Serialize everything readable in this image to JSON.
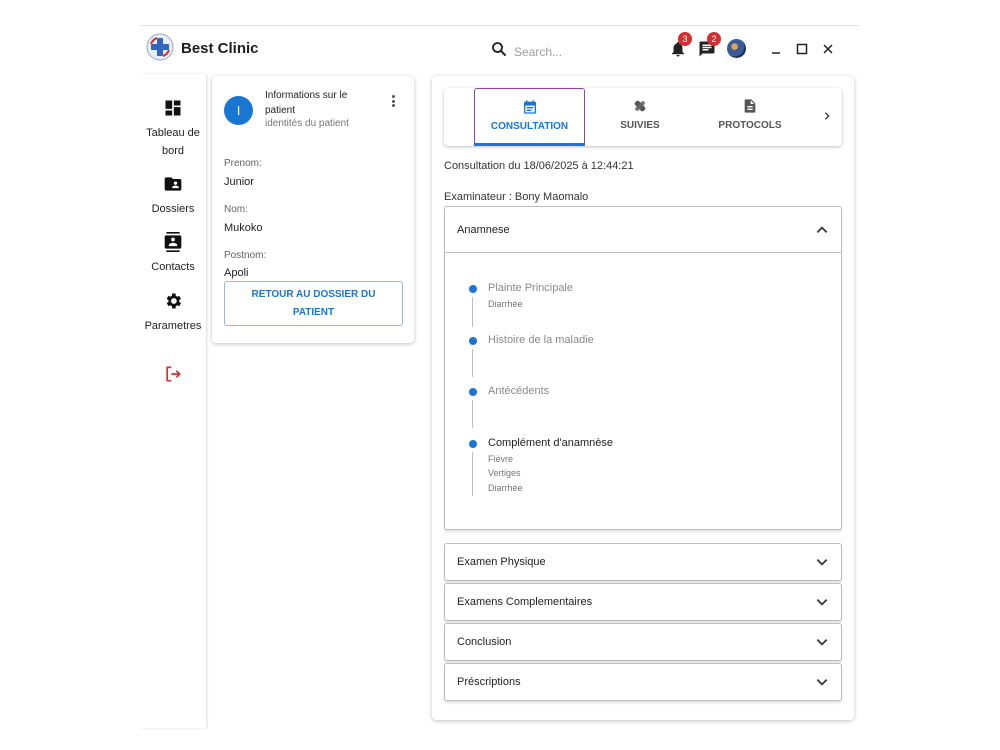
{
  "app": {
    "title": "Best Clinic"
  },
  "search": {
    "placeholder": "Search..."
  },
  "notifications": {
    "count": "3"
  },
  "messages": {
    "count": "2"
  },
  "nav": {
    "items": [
      {
        "label": "Tableau de bord",
        "icon": "dashboard-icon"
      },
      {
        "label": "Dossiers",
        "icon": "folder-shared-icon"
      },
      {
        "label": "Contacts",
        "icon": "contacts-icon"
      },
      {
        "label": "Parametres",
        "icon": "gear-icon"
      }
    ],
    "logout_icon": "logout-icon"
  },
  "patient": {
    "avatar_letter": "I",
    "card_title": "Informations sur le patient",
    "card_subtitle": "identités du patient",
    "fields": [
      {
        "label": "Prenom:",
        "value": "Junior"
      },
      {
        "label": "Nom:",
        "value": "Mukoko"
      },
      {
        "label": "Postnom:",
        "value": "Apoli"
      }
    ],
    "back_button": "RETOUR AU DOSSIER DU PATIENT"
  },
  "tabs": [
    {
      "label": "CONSULTATION",
      "icon": "calendar-icon",
      "active": true
    },
    {
      "label": "SUIVIES",
      "icon": "bandage-icon",
      "active": false
    },
    {
      "label": "PROTOCOLS",
      "icon": "document-icon",
      "active": false
    }
  ],
  "consultation": {
    "date_text": "Consultation du 18/06/2025 à 12:44:21",
    "examiner_text": "Examinateur : Bony Maomalo"
  },
  "sections": [
    {
      "title": "Anamnese",
      "open": true,
      "timeline": [
        {
          "title": "Plainte Principale",
          "items": [
            "Diarrhée"
          ]
        },
        {
          "title": "Histoire de la maladie",
          "items": []
        },
        {
          "title": "Antécédents",
          "items": []
        },
        {
          "title": "Complément d'anamnèse",
          "items": [
            "Fièvre",
            "Vertiges",
            "Diarrhée"
          ]
        }
      ]
    },
    {
      "title": "Examen Physique",
      "open": false
    },
    {
      "title": "Examens Complementaires",
      "open": false
    },
    {
      "title": "Conclusion",
      "open": false
    },
    {
      "title": "Préscriptions",
      "open": false
    }
  ],
  "colors": {
    "primary": "#1976d2",
    "badge": "#d32f2f",
    "logout": "#d32f2f",
    "active_tab_border": "#8e44ad"
  }
}
